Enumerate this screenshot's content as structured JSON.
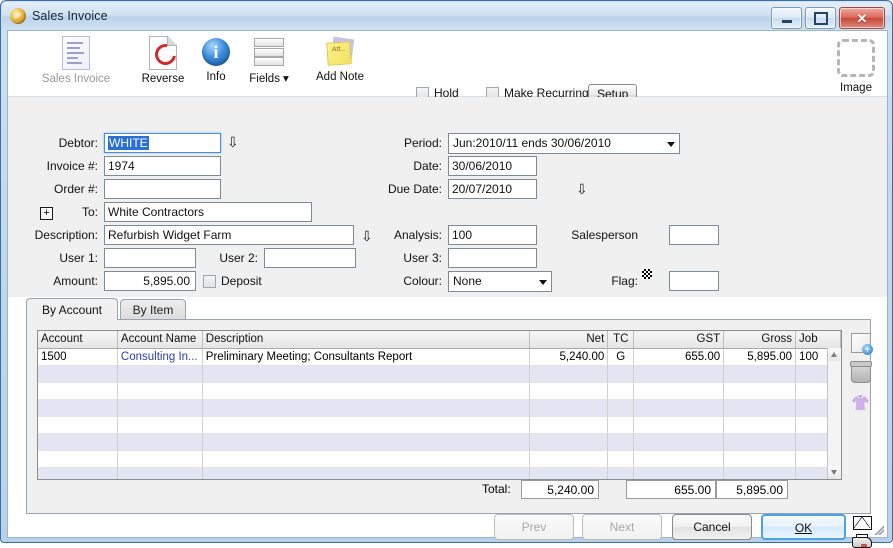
{
  "window": {
    "title": "Sales Invoice",
    "app_icon": "coin-icon",
    "minimize_label": "Minimize",
    "maximize_label": "Maximize",
    "close_label": "Close"
  },
  "toolbar": {
    "buttons": [
      {
        "label": "Sales Invoice",
        "icon": "invoice-document-icon",
        "disabled": true
      },
      {
        "label": "Reverse",
        "icon": "reverse-refresh-icon",
        "disabled": false
      },
      {
        "label": "Info",
        "icon": "info-circle-icon",
        "disabled": false
      },
      {
        "label": "Fields",
        "icon": "fields-rows-icon",
        "disabled": false
      },
      {
        "label": "Add Note",
        "icon": "sticky-note-icon",
        "disabled": false
      }
    ],
    "fields_caret": "▾",
    "hold_label": "Hold",
    "hold_checked": false,
    "make_recurring_label": "Make Recurring",
    "make_recurring_checked": false,
    "setup_label": "Setup",
    "image_label": "Image",
    "image_icon": "image-placeholder-icon"
  },
  "form": {
    "left": {
      "debtor_label": "Debtor:",
      "debtor_value": "WHITE",
      "debtor_selected": true,
      "invoice_label": "Invoice #:",
      "invoice_value": "1974",
      "order_label": "Order #:",
      "order_value": "",
      "to_label": "To:",
      "to_value": "White Contractors",
      "expander_glyph": "+",
      "description_label": "Description:",
      "description_value": "Refurbish Widget Farm",
      "user1_label": "User 1:",
      "user1_value": "",
      "user2_label": "User 2:",
      "user2_value": "",
      "amount_label": "Amount:",
      "amount_value": "5,895.00",
      "deposit_label": "Deposit",
      "deposit_checked": false
    },
    "right": {
      "period_label": "Period:",
      "period_value": "Jun:2010/11 ends 30/06/2010",
      "date_label": "Date:",
      "date_value": "30/06/2010",
      "due_date_label": "Due Date:",
      "due_date_value": "20/07/2010",
      "analysis_label": "Analysis:",
      "analysis_value": "100",
      "salesperson_label": "Salesperson",
      "salesperson_value": "",
      "user3_label": "User 3:",
      "user3_value": "",
      "colour_label": "Colour:",
      "colour_value": "None",
      "flag_label": "Flag:",
      "flag_value": ""
    }
  },
  "tabs": [
    {
      "label": "By Account",
      "active": true
    },
    {
      "label": "By Item",
      "active": false
    }
  ],
  "grid": {
    "columns": [
      "Account",
      "Account Name",
      "Description",
      "Net",
      "TC",
      "GST",
      "Gross",
      "Job"
    ],
    "rows": [
      {
        "account": "1500",
        "account_name": "Consulting In...",
        "description": "Preliminary Meeting; Consultants Report",
        "net": "5,240.00",
        "tc": "G",
        "gst": "655.00",
        "gross": "5,895.00",
        "job": "100"
      }
    ],
    "empty_row_count": 7,
    "totals": {
      "label": "Total:",
      "net": "5,240.00",
      "gst": "655.00",
      "gross": "5,895.00"
    },
    "scroll_up_glyph": "▲",
    "scroll_down_glyph": "▼"
  },
  "rail": [
    {
      "icon": "add-line-icon",
      "name": "add-line"
    },
    {
      "icon": "delete-line-trash-icon",
      "name": "delete-line"
    },
    {
      "icon": "find-binoculars-icon",
      "name": "find-line"
    }
  ],
  "footer": {
    "prev_label": "Prev",
    "prev_disabled": true,
    "next_label": "Next",
    "next_disabled": true,
    "cancel_label": "Cancel",
    "ok_label": "OK",
    "email_icon": "email-envelope-icon",
    "print_icon": "printer-icon"
  },
  "colors": {
    "titlebar_blue": "#bcd4ea",
    "close_red": "#c3483c",
    "selection_blue": "#2a6fd6",
    "link_blue": "#2a3fa8",
    "alt_row": "#e4e5f2",
    "default_button_border": "#4aa3e8"
  }
}
